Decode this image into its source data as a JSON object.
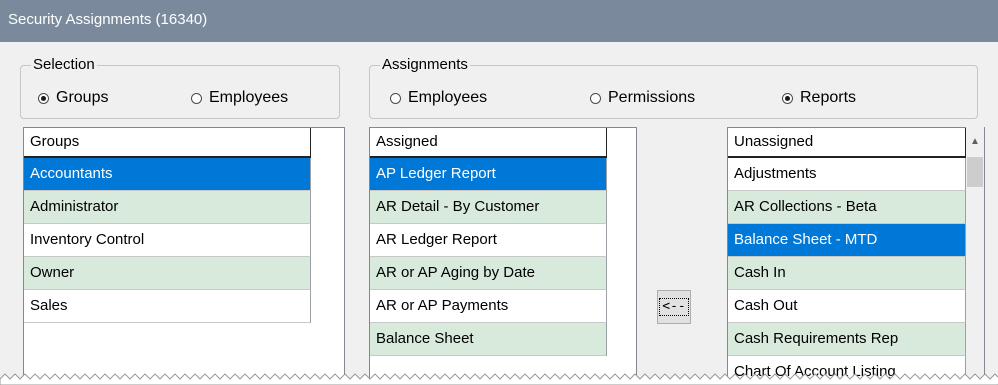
{
  "window": {
    "title": "Security Assignments (16340)"
  },
  "selection": {
    "legend": "Selection",
    "options": [
      {
        "label": "Groups",
        "checked": true
      },
      {
        "label": "Employees",
        "checked": false
      }
    ]
  },
  "assignments": {
    "legend": "Assignments",
    "options": [
      {
        "label": "Employees",
        "checked": false
      },
      {
        "label": "Permissions",
        "checked": false
      },
      {
        "label": "Reports",
        "checked": true
      }
    ]
  },
  "groups_list": {
    "header": "Groups",
    "items": [
      "Accountants",
      "Administrator",
      "Inventory Control",
      "Owner",
      "Sales"
    ],
    "selected": "Accountants"
  },
  "assigned_list": {
    "header": "Assigned",
    "items": [
      "AP Ledger Report",
      "AR Detail - By Customer",
      "AR Ledger Report",
      "AR or AP Aging by Date",
      "AR or AP Payments",
      "Balance Sheet"
    ],
    "selected": "AP Ledger Report"
  },
  "move_button": {
    "label": "<--"
  },
  "unassigned_list": {
    "header": "Unassigned",
    "items": [
      "Adjustments",
      "AR Collections - Beta",
      "Balance Sheet - MTD",
      "Cash In",
      "Cash Out",
      "Cash Requirements Rep",
      "Chart Of Account Listing"
    ],
    "selected": "Balance Sheet - MTD"
  },
  "colors": {
    "selected": "#0078d7",
    "alternate_row": "#d8eadb",
    "titlebar": "#7a8a9c"
  }
}
